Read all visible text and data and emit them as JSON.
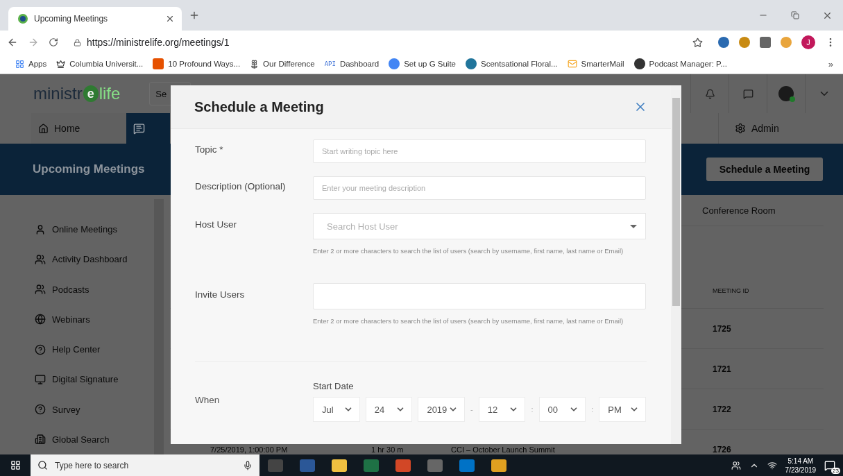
{
  "browser": {
    "tab": {
      "title": "Upcoming Meetings",
      "selected": true
    },
    "url": "https://ministrelife.org/meetings/1",
    "profile_initial": "J",
    "bookmarks": [
      {
        "kind": "apps",
        "label": "Apps"
      },
      {
        "kind": "crown",
        "label": "Columbia Universit..."
      },
      {
        "kind": "square",
        "label": "10 Profound Ways..."
      },
      {
        "kind": "flower",
        "label": "Our Difference"
      },
      {
        "kind": "api",
        "badge": "API",
        "label": "Dashboard"
      },
      {
        "kind": "google",
        "label": "Set up G Suite"
      },
      {
        "kind": "wordpress",
        "label": "Scentsational Floral..."
      },
      {
        "kind": "mail",
        "label": "SmarterMail"
      },
      {
        "kind": "podcast",
        "label": "Podcast Manager: P..."
      }
    ],
    "more": "»"
  },
  "app": {
    "logo": {
      "part_1": "ministr",
      "mark": "e",
      "part_2": "life"
    },
    "search_fragment": "Se",
    "nav": [
      {
        "label": "Home",
        "selected": false
      },
      {
        "kind": "chat",
        "selected": true
      }
    ],
    "admin": "Admin",
    "page_title": "Upcoming Meetings",
    "primary_button": "Schedule a Meeting",
    "sidebar": [
      {
        "kind": "person",
        "label": "Online Meetings"
      },
      {
        "kind": "group",
        "label": "Activity Dashboard"
      },
      {
        "kind": "group",
        "label": "Podcasts"
      },
      {
        "kind": "globe",
        "label": "Webinars"
      },
      {
        "kind": "help",
        "label": "Help Center"
      },
      {
        "kind": "monitor",
        "label": "Digital Signature"
      },
      {
        "kind": "help",
        "label": "Survey"
      },
      {
        "kind": "building",
        "label": "Global Search"
      }
    ],
    "table": {
      "tab": "Conference Room",
      "id_header": "MEETING ID",
      "rows": [
        {
          "meeting_id": "1725"
        },
        {
          "meeting_id": "1721"
        },
        {
          "meeting_id": "1722"
        },
        {
          "start": "7/25/2019, 1:00:00 PM",
          "duration": "1 hr 30 m",
          "topic": "CCI – October Launch Summit",
          "meeting_id": "1726"
        }
      ]
    }
  },
  "modal": {
    "title": "Schedule a Meeting",
    "fields": [
      {
        "kind": "text",
        "label": "Topic *",
        "placeholder": "Start writing topic here"
      },
      {
        "kind": "text",
        "label": "Description (Optional)",
        "placeholder": "Enter your meeting description"
      },
      {
        "kind": "select",
        "label": "Host User",
        "placeholder": "Search Host User",
        "hint": "Enter 2 or more characters to search the list of users (search by username, first name, last name or Email)"
      },
      {
        "kind": "text",
        "label": "Invite Users",
        "hint": "Enter 2 or more characters to search the list of users (search by username, first name, last name or Email)"
      }
    ],
    "when": {
      "label": "When",
      "start_label": "Start Date",
      "parts": [
        {
          "kind": "select",
          "value": "Jul"
        },
        {
          "kind": "select",
          "value": "24"
        },
        {
          "kind": "select",
          "value": "2019"
        },
        {
          "kind": "separator",
          "value": "-"
        },
        {
          "kind": "select",
          "value": "12"
        },
        {
          "kind": "separator",
          "value": ":"
        },
        {
          "kind": "select",
          "value": "00"
        },
        {
          "kind": "separator",
          "value": ":"
        },
        {
          "kind": "select",
          "value": "PM"
        }
      ]
    }
  },
  "taskbar": {
    "search_placeholder": "Type here to search",
    "time": "5:14 AM",
    "date": "7/23/2019",
    "notifications": "23"
  }
}
